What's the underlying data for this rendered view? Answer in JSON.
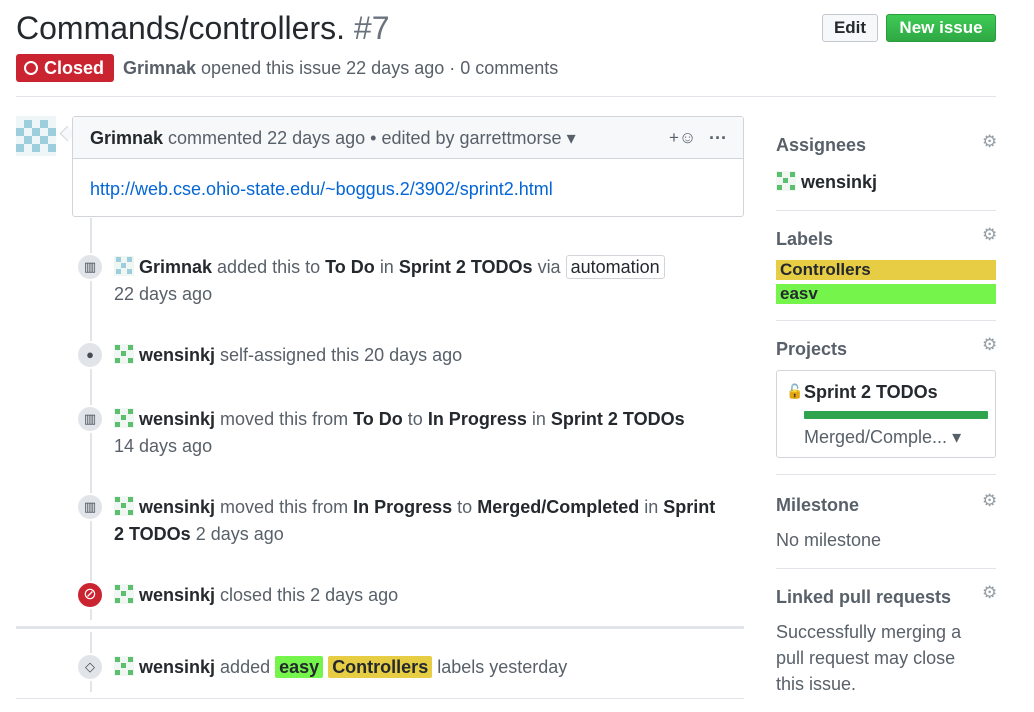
{
  "issue": {
    "title": "Commands/controllers.",
    "number": "#7",
    "status": "Closed",
    "author": "Grimnak",
    "opened_text": "opened this issue 22 days ago · 0 comments"
  },
  "toolbar": {
    "edit_label": "Edit",
    "new_issue_label": "New issue"
  },
  "comment": {
    "author": "Grimnak",
    "meta": "commented 22 days ago • edited by garrettmorse",
    "link": "http://web.cse.ohio-state.edu/~boggus.2/3902/sprint2.html",
    "reaction_label": "+☺",
    "more_label": "···"
  },
  "timeline": [
    {
      "icon": "project-icon",
      "user": "Grimnak",
      "t1": "added this to",
      "b1": "To Do",
      "t2": "in",
      "b2": "Sprint 2 TODOs",
      "t3": "via",
      "pill": "automation",
      "time": "22 days ago"
    },
    {
      "icon": "person-icon",
      "user": "wensinkj",
      "text": "self-assigned this 20 days ago"
    },
    {
      "icon": "project-icon",
      "user": "wensinkj",
      "t1": "moved this from",
      "b1": "To Do",
      "t2": "to",
      "b2": "In Progress",
      "t3": "in",
      "b3": "Sprint 2 TODOs",
      "time": "14 days ago"
    },
    {
      "icon": "project-icon",
      "user": "wensinkj",
      "t1": "moved this from",
      "b1": "In Progress",
      "t2": "to",
      "b2": "Merged/Completed",
      "t3": "in",
      "b3": "Sprint",
      "b4": "2 TODOs",
      "time": "2 days ago"
    },
    {
      "icon": "closed-icon",
      "user": "wensinkj",
      "text": "closed this 2 days ago"
    },
    {
      "icon": "tag-icon",
      "user": "wensinkj",
      "t1": "added",
      "l1": "easy",
      "l2": "Controllers",
      "t2": "labels yesterday"
    }
  ],
  "sidebar": {
    "assignees": {
      "heading": "Assignees",
      "user": "wensinkj"
    },
    "labels": {
      "heading": "Labels",
      "items": [
        "Controllers",
        "easv"
      ]
    },
    "projects": {
      "heading": "Projects",
      "name": "Sprint 2 TODOs",
      "column": "Merged/Comple...",
      "progress": 1.0
    },
    "milestone": {
      "heading": "Milestone",
      "value": "No milestone"
    },
    "linked": {
      "heading": "Linked pull requests",
      "line1": "Successfully merging a",
      "line2": "pull request may close",
      "line3": "this issue."
    }
  },
  "colors": {
    "closed": "#cb2431",
    "new_issue": "#2ea44f",
    "label_controllers": "#e6cd44",
    "label_easy": "#75f54c",
    "link": "#0366d6"
  }
}
